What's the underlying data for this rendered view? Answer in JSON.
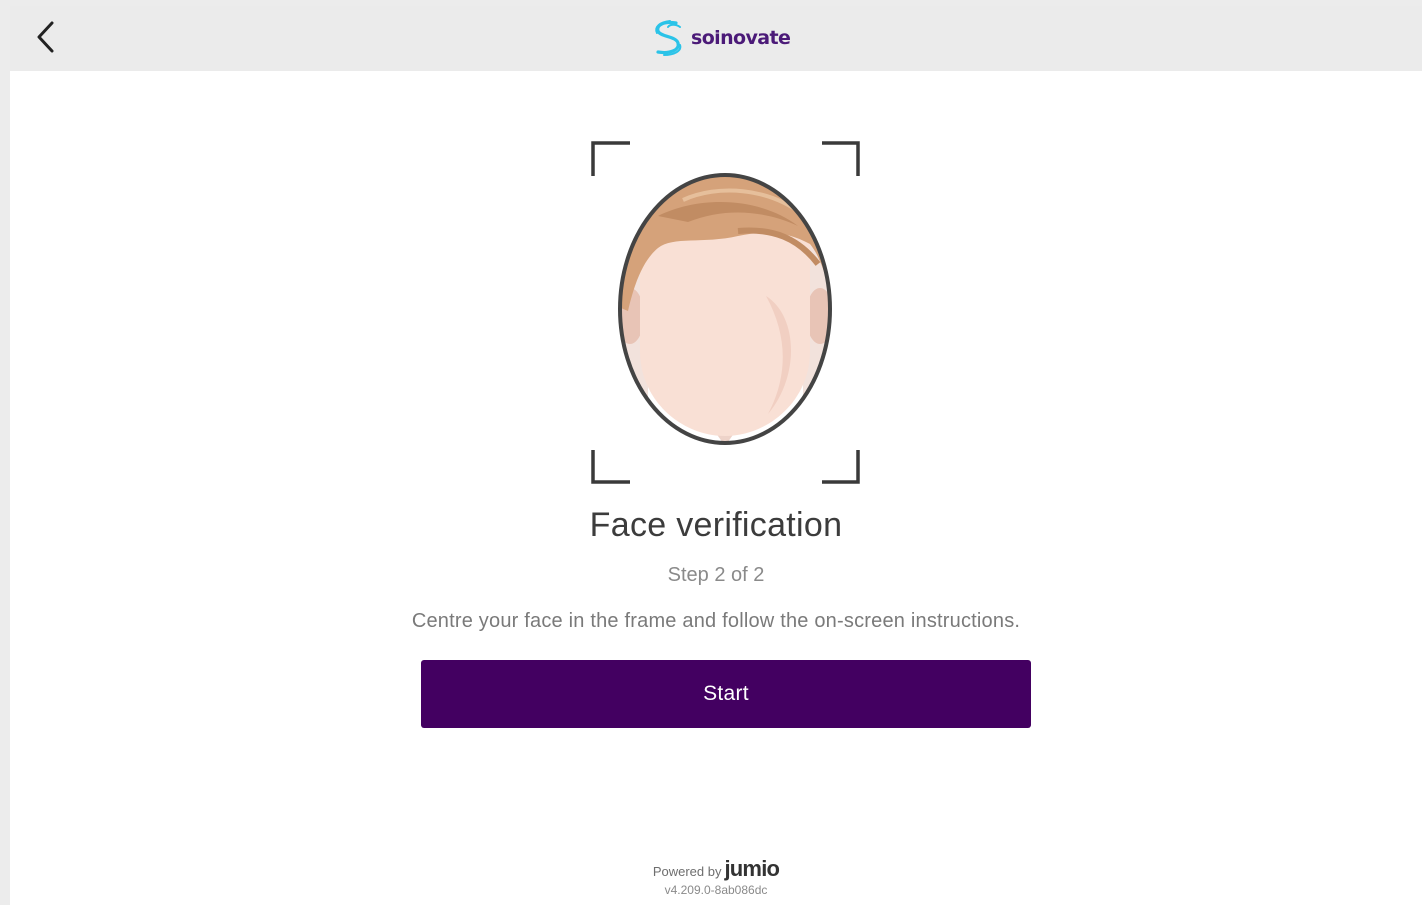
{
  "header": {
    "back_icon": "chevron-left-icon",
    "brand_name": "soinovate",
    "brand_colors": {
      "mark": "#2bc3e8",
      "name": "#4b1a78"
    }
  },
  "main": {
    "illustration_icon": "face-frame-icon",
    "title": "Face verification",
    "step": "Step 2 of 2",
    "instructions": "Centre your face in the frame and follow the on-screen instructions.",
    "start_label": "Start",
    "accent_color": "#430061"
  },
  "footer": {
    "powered_by": "Powered by",
    "provider": "jumio",
    "version": "v4.209.0-8ab086dc"
  }
}
